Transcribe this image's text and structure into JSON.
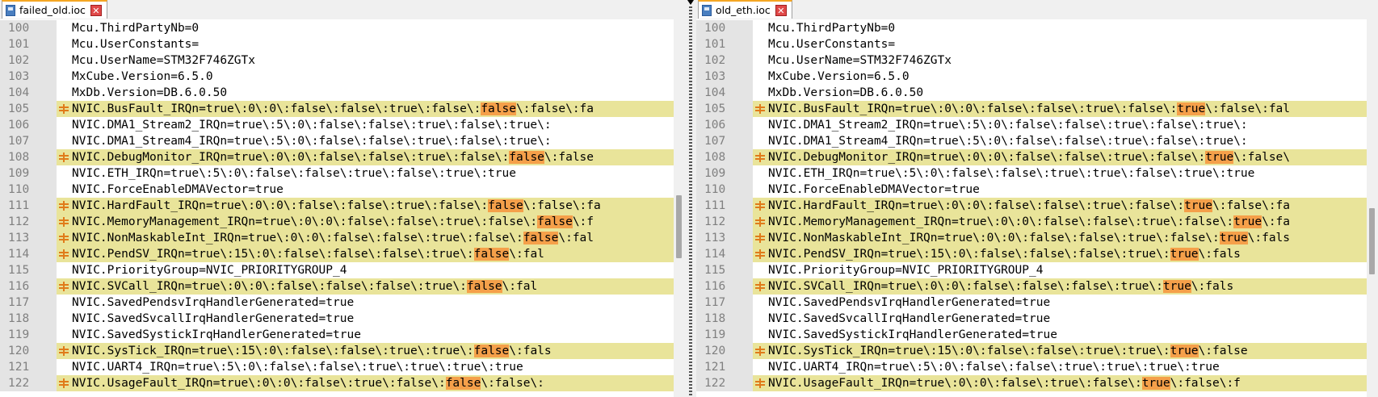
{
  "left": {
    "tab_title": "failed_old.ioc",
    "close_icon": "close-x-icon",
    "lines": [
      {
        "num": "100",
        "changed": false,
        "before": "Mcu.ThirdPartyNb=0",
        "hl": "",
        "after": ""
      },
      {
        "num": "101",
        "changed": false,
        "before": "Mcu.UserConstants=",
        "hl": "",
        "after": ""
      },
      {
        "num": "102",
        "changed": false,
        "before": "Mcu.UserName=STM32F746ZGTx",
        "hl": "",
        "after": ""
      },
      {
        "num": "103",
        "changed": false,
        "before": "MxCube.Version=6.5.0",
        "hl": "",
        "after": ""
      },
      {
        "num": "104",
        "changed": false,
        "before": "MxDb.Version=DB.6.0.50",
        "hl": "",
        "after": ""
      },
      {
        "num": "105",
        "changed": true,
        "before": "NVIC.BusFault_IRQn=true\\:0\\:0\\:false\\:false\\:true\\:false\\:",
        "hl": "false",
        "after": "\\:false\\:fa"
      },
      {
        "num": "106",
        "changed": false,
        "before": "NVIC.DMA1_Stream2_IRQn=true\\:5\\:0\\:false\\:false\\:true\\:false\\:true\\:",
        "hl": "",
        "after": ""
      },
      {
        "num": "107",
        "changed": false,
        "before": "NVIC.DMA1_Stream4_IRQn=true\\:5\\:0\\:false\\:false\\:true\\:false\\:true\\:",
        "hl": "",
        "after": ""
      },
      {
        "num": "108",
        "changed": true,
        "before": "NVIC.DebugMonitor_IRQn=true\\:0\\:0\\:false\\:false\\:true\\:false\\:",
        "hl": "false",
        "after": "\\:false"
      },
      {
        "num": "109",
        "changed": false,
        "before": "NVIC.ETH_IRQn=true\\:5\\:0\\:false\\:false\\:true\\:false\\:true\\:true",
        "hl": "",
        "after": ""
      },
      {
        "num": "110",
        "changed": false,
        "before": "NVIC.ForceEnableDMAVector=true",
        "hl": "",
        "after": ""
      },
      {
        "num": "111",
        "changed": true,
        "before": "NVIC.HardFault_IRQn=true\\:0\\:0\\:false\\:false\\:true\\:false\\:",
        "hl": "false",
        "after": "\\:false\\:fa"
      },
      {
        "num": "112",
        "changed": true,
        "before": "NVIC.MemoryManagement_IRQn=true\\:0\\:0\\:false\\:false\\:true\\:false\\:",
        "hl": "false",
        "after": "\\:f"
      },
      {
        "num": "113",
        "changed": true,
        "before": "NVIC.NonMaskableInt_IRQn=true\\:0\\:0\\:false\\:false\\:true\\:false\\:",
        "hl": "false",
        "after": "\\:fal"
      },
      {
        "num": "114",
        "changed": true,
        "before": "NVIC.PendSV_IRQn=true\\:15\\:0\\:false\\:false\\:false\\:true\\:",
        "hl": "false",
        "after": "\\:fal"
      },
      {
        "num": "115",
        "changed": false,
        "before": "NVIC.PriorityGroup=NVIC_PRIORITYGROUP_4",
        "hl": "",
        "after": ""
      },
      {
        "num": "116",
        "changed": true,
        "before": "NVIC.SVCall_IRQn=true\\:0\\:0\\:false\\:false\\:false\\:true\\:",
        "hl": "false",
        "after": "\\:fal"
      },
      {
        "num": "117",
        "changed": false,
        "before": "NVIC.SavedPendsvIrqHandlerGenerated=true",
        "hl": "",
        "after": ""
      },
      {
        "num": "118",
        "changed": false,
        "before": "NVIC.SavedSvcallIrqHandlerGenerated=true",
        "hl": "",
        "after": ""
      },
      {
        "num": "119",
        "changed": false,
        "before": "NVIC.SavedSystickIrqHandlerGenerated=true",
        "hl": "",
        "after": ""
      },
      {
        "num": "120",
        "changed": true,
        "before": "NVIC.SysTick_IRQn=true\\:15\\:0\\:false\\:false\\:true\\:true\\:",
        "hl": "false",
        "after": "\\:fals"
      },
      {
        "num": "121",
        "changed": false,
        "before": "NVIC.UART4_IRQn=true\\:5\\:0\\:false\\:false\\:true\\:true\\:true\\:true",
        "hl": "",
        "after": ""
      },
      {
        "num": "122",
        "changed": true,
        "before": "NVIC.UsageFault_IRQn=true\\:0\\:0\\:false\\:true\\:false\\:",
        "hl": "false",
        "after": "\\:false\\:"
      }
    ]
  },
  "right": {
    "tab_title": "old_eth.ioc",
    "close_icon": "close-x-icon",
    "lines": [
      {
        "num": "100",
        "changed": false,
        "before": "Mcu.ThirdPartyNb=0",
        "hl": "",
        "after": ""
      },
      {
        "num": "101",
        "changed": false,
        "before": "Mcu.UserConstants=",
        "hl": "",
        "after": ""
      },
      {
        "num": "102",
        "changed": false,
        "before": "Mcu.UserName=STM32F746ZGTx",
        "hl": "",
        "after": ""
      },
      {
        "num": "103",
        "changed": false,
        "before": "MxCube.Version=6.5.0",
        "hl": "",
        "after": ""
      },
      {
        "num": "104",
        "changed": false,
        "before": "MxDb.Version=DB.6.0.50",
        "hl": "",
        "after": ""
      },
      {
        "num": "105",
        "changed": true,
        "before": "NVIC.BusFault_IRQn=true\\:0\\:0\\:false\\:false\\:true\\:false\\:",
        "hl": "true",
        "after": "\\:false\\:fal"
      },
      {
        "num": "106",
        "changed": false,
        "before": "NVIC.DMA1_Stream2_IRQn=true\\:5\\:0\\:false\\:false\\:true\\:false\\:true\\:",
        "hl": "",
        "after": ""
      },
      {
        "num": "107",
        "changed": false,
        "before": "NVIC.DMA1_Stream4_IRQn=true\\:5\\:0\\:false\\:false\\:true\\:false\\:true\\:",
        "hl": "",
        "after": ""
      },
      {
        "num": "108",
        "changed": true,
        "before": "NVIC.DebugMonitor_IRQn=true\\:0\\:0\\:false\\:false\\:true\\:false\\:",
        "hl": "true",
        "after": "\\:false\\"
      },
      {
        "num": "109",
        "changed": false,
        "before": "NVIC.ETH_IRQn=true\\:5\\:0\\:false\\:false\\:true\\:true\\:false\\:true\\:true",
        "hl": "",
        "after": ""
      },
      {
        "num": "110",
        "changed": false,
        "before": "NVIC.ForceEnableDMAVector=true",
        "hl": "",
        "after": ""
      },
      {
        "num": "111",
        "changed": true,
        "before": "NVIC.HardFault_IRQn=true\\:0\\:0\\:false\\:false\\:true\\:false\\:",
        "hl": "true",
        "after": "\\:false\\:fa"
      },
      {
        "num": "112",
        "changed": true,
        "before": "NVIC.MemoryManagement_IRQn=true\\:0\\:0\\:false\\:false\\:true\\:false\\:",
        "hl": "true",
        "after": "\\:fa"
      },
      {
        "num": "113",
        "changed": true,
        "before": "NVIC.NonMaskableInt_IRQn=true\\:0\\:0\\:false\\:false\\:true\\:false\\:",
        "hl": "true",
        "after": "\\:fals"
      },
      {
        "num": "114",
        "changed": true,
        "before": "NVIC.PendSV_IRQn=true\\:15\\:0\\:false\\:false\\:false\\:true\\:",
        "hl": "true",
        "after": "\\:fals"
      },
      {
        "num": "115",
        "changed": false,
        "before": "NVIC.PriorityGroup=NVIC_PRIORITYGROUP_4",
        "hl": "",
        "after": ""
      },
      {
        "num": "116",
        "changed": true,
        "before": "NVIC.SVCall_IRQn=true\\:0\\:0\\:false\\:false\\:false\\:true\\:",
        "hl": "true",
        "after": "\\:fals"
      },
      {
        "num": "117",
        "changed": false,
        "before": "NVIC.SavedPendsvIrqHandlerGenerated=true",
        "hl": "",
        "after": ""
      },
      {
        "num": "118",
        "changed": false,
        "before": "NVIC.SavedSvcallIrqHandlerGenerated=true",
        "hl": "",
        "after": ""
      },
      {
        "num": "119",
        "changed": false,
        "before": "NVIC.SavedSystickIrqHandlerGenerated=true",
        "hl": "",
        "after": ""
      },
      {
        "num": "120",
        "changed": true,
        "before": "NVIC.SysTick_IRQn=true\\:15\\:0\\:false\\:false\\:true\\:true\\:",
        "hl": "true",
        "after": "\\:false"
      },
      {
        "num": "121",
        "changed": false,
        "before": "NVIC.UART4_IRQn=true\\:5\\:0\\:false\\:false\\:true\\:true\\:true\\:true",
        "hl": "",
        "after": ""
      },
      {
        "num": "122",
        "changed": true,
        "before": "NVIC.UsageFault_IRQn=true\\:0\\:0\\:false\\:true\\:false\\:",
        "hl": "true",
        "after": "\\:false\\:f"
      }
    ]
  },
  "colors": {
    "changed_line_bg": "#e9e49a",
    "diff_highlight": "#f5a04a",
    "diff_marker": "#e07b1a",
    "gutter_bg": "#e4e4e4",
    "line_number": "#808080"
  },
  "icons": {
    "file_icon": "file-icon",
    "diff_marker": "changed-line-marker-icon"
  }
}
